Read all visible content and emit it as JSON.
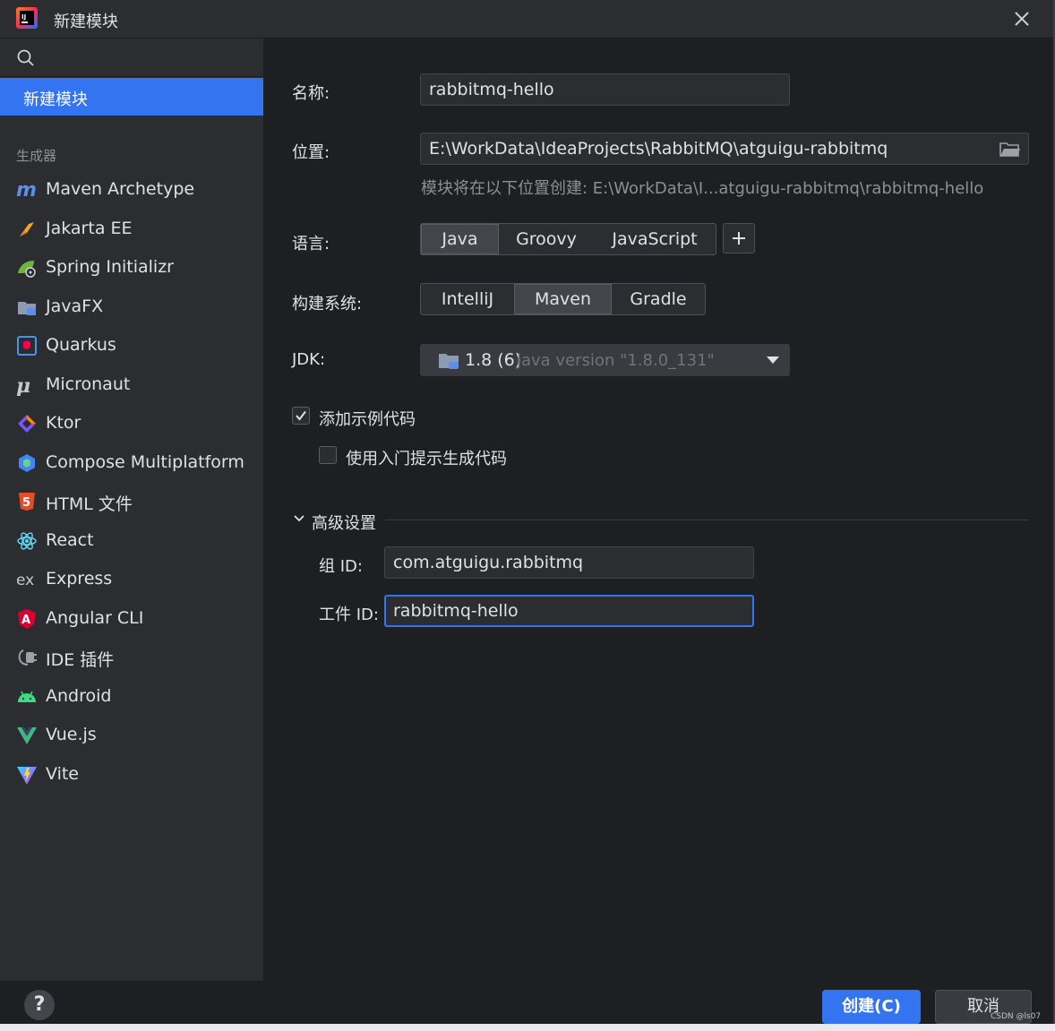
{
  "window": {
    "title": "新建模块"
  },
  "sidebar": {
    "selected": "新建模块",
    "group_label": "生成器",
    "items": [
      {
        "label": "Maven Archetype",
        "icon": "maven-icon"
      },
      {
        "label": "Jakarta EE",
        "icon": "jakarta-icon"
      },
      {
        "label": "Spring Initializr",
        "icon": "spring-icon"
      },
      {
        "label": "JavaFX",
        "icon": "javafx-icon"
      },
      {
        "label": "Quarkus",
        "icon": "quarkus-icon"
      },
      {
        "label": "Micronaut",
        "icon": "micronaut-icon"
      },
      {
        "label": "Ktor",
        "icon": "ktor-icon"
      },
      {
        "label": "Compose Multiplatform",
        "icon": "compose-icon"
      },
      {
        "label": "HTML 文件",
        "icon": "html5-icon"
      },
      {
        "label": "React",
        "icon": "react-icon"
      },
      {
        "label": "Express",
        "icon": "express-icon"
      },
      {
        "label": "Angular CLI",
        "icon": "angular-icon"
      },
      {
        "label": "IDE 插件",
        "icon": "plugin-icon"
      },
      {
        "label": "Android",
        "icon": "android-icon"
      },
      {
        "label": "Vue.js",
        "icon": "vue-icon"
      },
      {
        "label": "Vite",
        "icon": "vite-icon"
      }
    ],
    "help": "?"
  },
  "form": {
    "name_label": "名称:",
    "name_value": "rabbitmq-hello",
    "location_label": "位置:",
    "location_value": "E:\\WorkData\\IdeaProjects\\RabbitMQ\\atguigu-rabbitmq",
    "location_hint": "模块将在以下位置创建: E:\\WorkData\\I...atguigu-rabbitmq\\rabbitmq-hello",
    "language_label": "语言:",
    "languages": [
      "Java",
      "Groovy",
      "JavaScript"
    ],
    "language_selected": "Java",
    "build_label": "构建系统:",
    "build_systems": [
      "IntelliJ",
      "Maven",
      "Gradle"
    ],
    "build_selected": "Maven",
    "jdk_label": "JDK:",
    "jdk_version": "1.8 (6)",
    "jdk_detail": "java version \"1.8.0_131\"",
    "sample_code_label": "添加示例代码",
    "sample_code_checked": true,
    "onboarding_label": "使用入门提示生成代码",
    "onboarding_checked": false,
    "advanced_label": "高级设置",
    "group_id_label": "组 ID:",
    "group_id_value": "com.atguigu.rabbitmq",
    "artifact_id_label": "工件 ID:",
    "artifact_id_value": "rabbitmq-hello"
  },
  "buttons": {
    "create": "创建(C)",
    "cancel": "取消"
  },
  "watermark": "CSDN @ls07",
  "colors": {
    "accent": "#3574f0",
    "background": "#1e1f22",
    "panel": "#2b2d30"
  }
}
